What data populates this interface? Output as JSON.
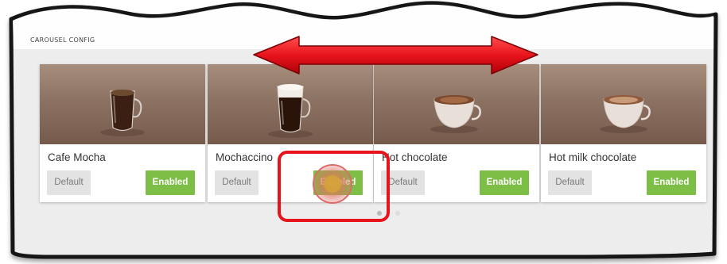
{
  "panel": {
    "title": "CAROUSEL CONFIG"
  },
  "carousel": {
    "items": [
      {
        "name": "Cafe Mocha",
        "default_label": "Default",
        "enabled_label": "Enabled",
        "status": "enabled"
      },
      {
        "name": "Mochaccino",
        "default_label": "Default",
        "enabled_label": "Enabled",
        "status": "enabled"
      },
      {
        "name": "Hot chocolate",
        "default_label": "Default",
        "enabled_label": "Enabled",
        "status": "enabled"
      },
      {
        "name": "Hot milk chocolate",
        "default_label": "Default",
        "enabled_label": "Enabled",
        "status": "enabled"
      }
    ],
    "pager": {
      "pages": 2,
      "active_index": 0
    }
  },
  "annotations": {
    "arrow_color": "#e8141c",
    "highlight_color": "#e8141c"
  },
  "colors": {
    "accent_green": "#7dbf46",
    "default_grey": "#e3e3e3",
    "panel_bg": "#ededed"
  }
}
